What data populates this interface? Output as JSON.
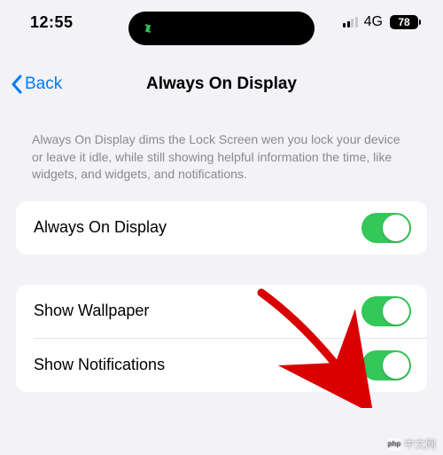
{
  "status_bar": {
    "time": "12:55",
    "network": "4G",
    "battery": "78"
  },
  "nav": {
    "back_label": "Back",
    "title": "Always On Display"
  },
  "description": "Always On Display dims the Lock Screen wen you lock your device or leave it idle, while still showing helpful information the time, like widgets, and widgets, and notifications.",
  "settings": {
    "group1": [
      {
        "label": "Always On Display",
        "on": true
      }
    ],
    "group2": [
      {
        "label": "Show Wallpaper",
        "on": true
      },
      {
        "label": "Show Notifications",
        "on": true
      }
    ]
  },
  "watermark": "中文网"
}
